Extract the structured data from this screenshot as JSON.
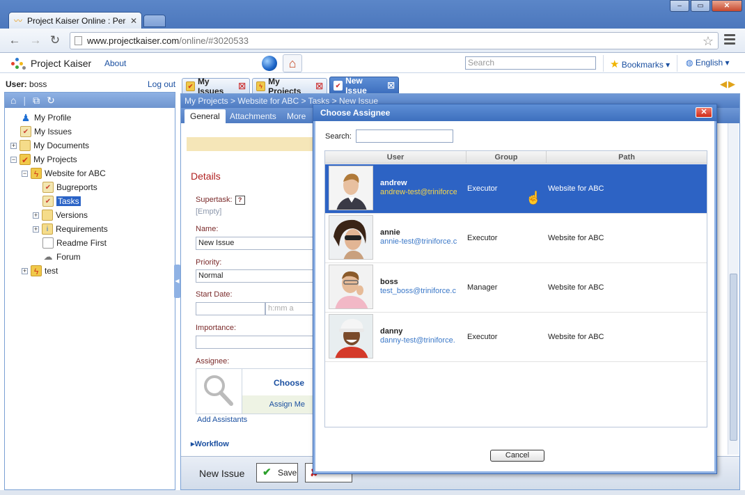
{
  "browser": {
    "tab_title": "Project Kaiser Online : Persona",
    "url_host": "www.projectkaiser.com",
    "url_path": "/online/#3020533",
    "window_controls": [
      "–",
      "▭",
      "✕"
    ]
  },
  "header": {
    "logo_text": "Project Kaiser",
    "about": "About",
    "search_placeholder": "Search",
    "bookmarks": "Bookmarks ▾",
    "language": "English ▾"
  },
  "user": {
    "label": "User:",
    "name": "boss",
    "logout": "Log out"
  },
  "tree": [
    {
      "label": "My Profile",
      "icon": "person-icon"
    },
    {
      "label": "My Issues",
      "icon": "issues-icon"
    },
    {
      "label": "My Documents",
      "icon": "documents-icon"
    },
    {
      "label": "My Projects",
      "icon": "projects-icon"
    },
    {
      "label": "Website for ABC",
      "icon": "project-icon"
    },
    {
      "label": "Bugreports",
      "icon": "issues-icon"
    },
    {
      "label": "Tasks",
      "icon": "issues-icon"
    },
    {
      "label": "Versions",
      "icon": "folder-icon"
    },
    {
      "label": "Requirements",
      "icon": "requirements-icon"
    },
    {
      "label": "Readme First",
      "icon": "page-icon"
    },
    {
      "label": "Forum",
      "icon": "forum-icon"
    },
    {
      "label": "test",
      "icon": "project-icon"
    }
  ],
  "tabs": {
    "my_issues": "My Issues",
    "my_projects": "My Projects",
    "new_issue": "New Issue"
  },
  "issue": {
    "breadcrumb": "My Projects > Website for ABC > Tasks > New Issue",
    "subtabs": [
      "General",
      "Attachments",
      "More"
    ],
    "details_title": "Details",
    "supertask_label": "Supertask:",
    "supertask_help": "?",
    "supertask_value": "[Empty]",
    "name_label": "Name:",
    "name_value": "New Issue",
    "priority_label": "Priority:",
    "priority_value": "Normal",
    "start_date_label": "Start Date:",
    "time_placeholder": "h:mm a",
    "importance_label": "Importance:",
    "assignee_label": "Assignee:",
    "choose": "Choose",
    "assign_me": "Assign Me",
    "add_assistants": "Add Assistants",
    "workflow": "Workflow",
    "bottom_title": "New Issue",
    "save": "Save"
  },
  "dialog": {
    "title": "Choose Assignee",
    "close": "✕",
    "search_label": "Search:",
    "columns": [
      "User",
      "Group",
      "Path"
    ],
    "rows": [
      {
        "name": "andrew",
        "email": "andrew-test@triniforce",
        "group": "Executor",
        "path": "Website for ABC",
        "selected": true
      },
      {
        "name": "annie",
        "email": "annie-test@triniforce.c",
        "group": "Executor",
        "path": "Website for ABC",
        "selected": false
      },
      {
        "name": "boss",
        "email": "test_boss@triniforce.c",
        "group": "Manager",
        "path": "Website for ABC",
        "selected": false
      },
      {
        "name": "danny",
        "email": "danny-test@triniforce.",
        "group": "Executor",
        "path": "Website for ABC",
        "selected": false
      }
    ],
    "cancel": "Cancel"
  },
  "colors": {
    "accent": "#3d6fbe",
    "selection": "#2d63c4",
    "details_title": "#b02020"
  }
}
